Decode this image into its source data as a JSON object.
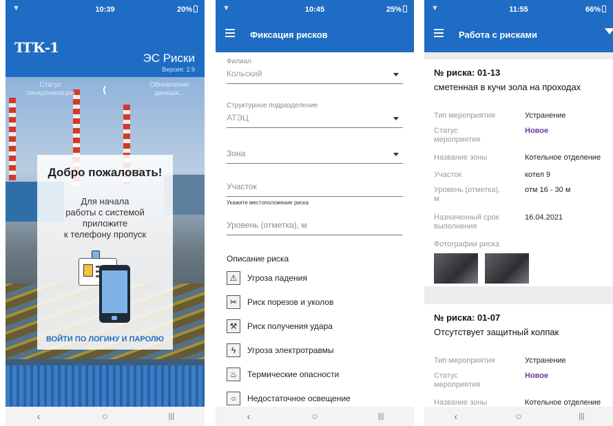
{
  "screen1": {
    "status": {
      "time": "10:39",
      "battery": "20%"
    },
    "logo": {
      "text": "ТГК-1"
    },
    "app_name": "ЭС Риски",
    "version": "Версия: 2.9",
    "sync_status": [
      "Статус",
      "синхронизации"
    ],
    "update_data": [
      "Обновление",
      "данных..."
    ],
    "welcome_title": "Добро пожаловать!",
    "instruction": [
      "Для начала",
      "работы с системой",
      "приложите",
      "к телефону пропуск"
    ],
    "login_link": "ВОЙТИ ПО ЛОГИНУ И ПАРОЛЮ"
  },
  "screen2": {
    "status": {
      "time": "10:45",
      "battery": "25%"
    },
    "title": "Фиксация рисков",
    "fields": {
      "branch": {
        "label": "Филиал",
        "value": "Кольский"
      },
      "division": {
        "label": "Структурное подразделение",
        "value": "АТЭЦ"
      },
      "zone": {
        "placeholder": "Зона"
      },
      "section": {
        "placeholder": "Участок",
        "hint": "Укажите местоположение риска"
      },
      "level": {
        "placeholder": "Уровень (отметка), м"
      }
    },
    "description_title": "Описание риска",
    "risks": [
      {
        "label": "Угроза падения",
        "icon": "fall-icon"
      },
      {
        "label": "Риск порезов и уколов",
        "icon": "cut-icon"
      },
      {
        "label": "Риск получения удара",
        "icon": "hammer-icon"
      },
      {
        "label": "Угроза электротравмы",
        "icon": "lightning-icon"
      },
      {
        "label": "Термические опасности",
        "icon": "thermometer-icon"
      },
      {
        "label": "Недостаточное освещение",
        "icon": "bulb-icon"
      }
    ]
  },
  "screen3": {
    "status": {
      "time": "11:55",
      "battery": "66%"
    },
    "title": "Работа с рисками",
    "cards": [
      {
        "number": "№ риска: 01-13",
        "title": "сметенная в кучи зола на проходах",
        "type_label": "Тип мероприятия",
        "type_value": "Устранение",
        "status_label": [
          "Статус",
          "мероприятия"
        ],
        "status_value": "Новое",
        "zone_label": "Название зоны",
        "zone_value": "Котельное отделение",
        "section_label": "Участок",
        "section_value": "котел 9",
        "level_label": [
          "Уровень (отметка),",
          "м"
        ],
        "level_value": "отм 16 - 30 м",
        "deadline_label": [
          "Назначенный срок",
          "выполнения"
        ],
        "deadline_value": "16.04.2021",
        "photos_label": "Фотографии риска"
      },
      {
        "number": "№ риска: 01-07",
        "title": "Отсутствует защитный колпак",
        "type_label": "Тип мероприятия",
        "type_value": "Устранение",
        "status_label": [
          "Статус",
          "мероприятия"
        ],
        "status_value": "Новое",
        "zone_label": "Название зоны",
        "zone_value": "Котельное отделение"
      }
    ]
  },
  "nav": {
    "back": "‹",
    "home": "○",
    "recent": "|||"
  },
  "colors": {
    "brand_blue": "#1f6cc4",
    "status_new": "#6c3aa0"
  }
}
